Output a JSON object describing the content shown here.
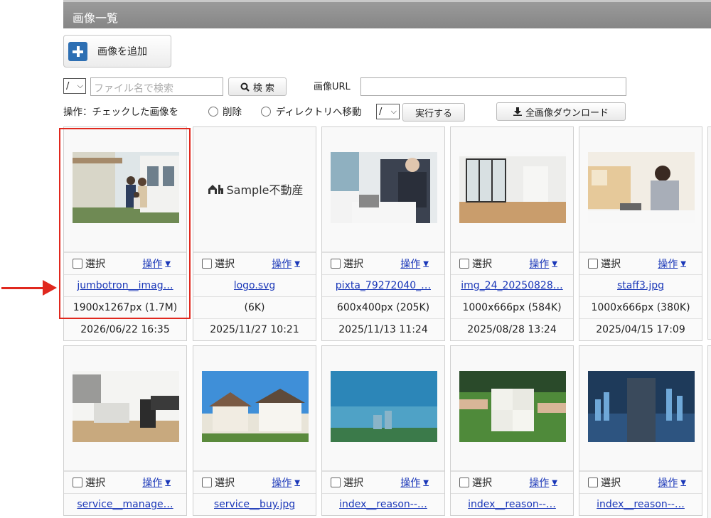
{
  "header": {
    "title": "画像一覧"
  },
  "toolbar": {
    "add_label": "画像を追加",
    "page_select": "/",
    "search_placeholder": "ファイル名で検索",
    "search_label": "検 索",
    "url_label": "画像URL",
    "url_value": "",
    "ops_label": "操作：チェックした画像を",
    "opt_delete": "削除",
    "opt_move": "ディレクトリへ移動",
    "dir_select": "/",
    "exec_label": "実行する",
    "download_label": "全画像ダウンロード"
  },
  "card_labels": {
    "select": "選択",
    "operation": "操作"
  },
  "images_row1": [
    {
      "name": "jumbotron__imag…",
      "size": "1900x1267px (1.7M)",
      "date": "2026/06/22 16:35"
    },
    {
      "name": "logo.svg",
      "size": "(6K)",
      "date": "2025/11/27 10:21",
      "logo_text": "Sample不動産"
    },
    {
      "name": "pixta_79272040_…",
      "size": "600x400px (205K)",
      "date": "2025/11/13 11:24"
    },
    {
      "name": "img_24_20250828…",
      "size": "1000x666px (584K)",
      "date": "2025/08/28 13:24"
    },
    {
      "name": "staff3.jpg",
      "size": "1000x666px (380K)",
      "date": "2025/04/15 17:09"
    }
  ],
  "images_row2": [
    {
      "name": "service__manage…"
    },
    {
      "name": "service__buy.jpg"
    },
    {
      "name": "index__reason--…"
    },
    {
      "name": "index__reason--…"
    },
    {
      "name": "index__reason--…"
    }
  ],
  "colors": {
    "highlight": "#e0281e",
    "link": "#1a37b8",
    "header_bg": "#8c8c8c",
    "add_icon": "#2d6fb3"
  }
}
